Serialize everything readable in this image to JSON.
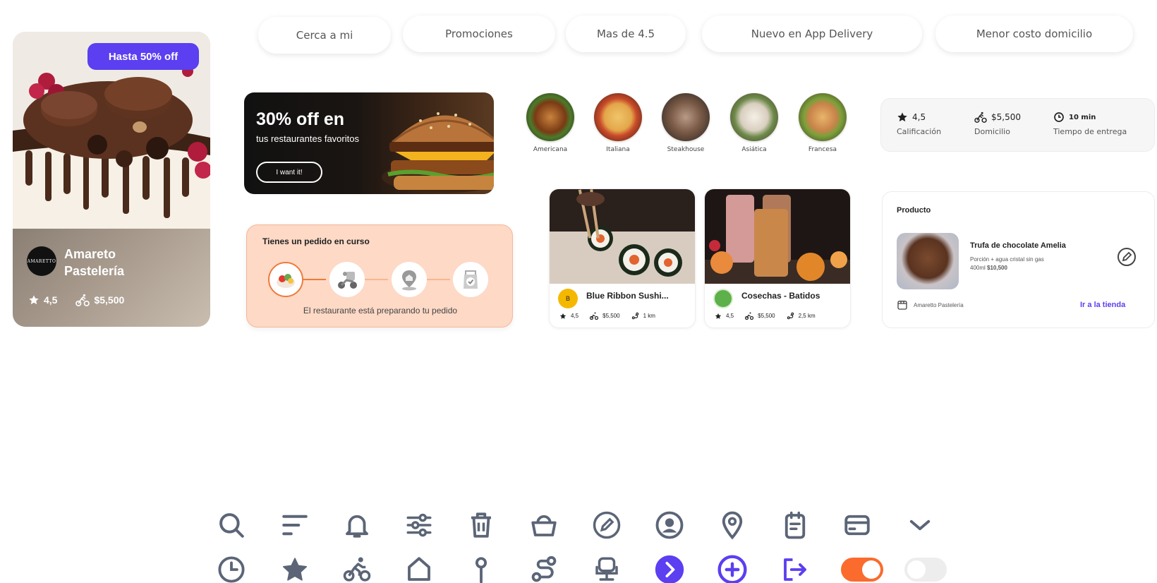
{
  "filters": [
    "Cerca a mi",
    "Promociones",
    "Mas de 4.5",
    "Nuevo en App Delivery",
    "Menor costo domicilio"
  ],
  "pastry_card": {
    "badge": "Hasta 50% off",
    "logo_text": "AMARETTO",
    "name": "Amareto Pastelería",
    "rating": "4,5",
    "delivery": "$5,500"
  },
  "banner": {
    "title": "30% off en",
    "subtitle": "tus restaurantes favoritos",
    "cta": "I want it!"
  },
  "categories": [
    {
      "label": "Americana"
    },
    {
      "label": "Italiana"
    },
    {
      "label": "Steakhouse"
    },
    {
      "label": "Asiática"
    },
    {
      "label": "Francesa"
    }
  ],
  "stats": {
    "rating_value": "4,5",
    "rating_label": "Calificación",
    "delivery_value": "$5,500",
    "delivery_label": "Domicilio",
    "time_value": "10 min",
    "time_label": "Tiempo de entrega"
  },
  "order": {
    "title": "Tienes un pedido en curso",
    "status": "El restaurante está preparando tu pedido"
  },
  "restaurants": [
    {
      "name": "Blue Ribbon Sushi...",
      "logo": "B",
      "rating": "4,5",
      "delivery": "$5,500",
      "distance": "1 km"
    },
    {
      "name": "Cosechas - Batidos",
      "logo": "",
      "rating": "4,5",
      "delivery": "$5,500",
      "distance": "2,5 km"
    }
  ],
  "product": {
    "header": "Producto",
    "name": "Trufa de chocolate Amelia",
    "desc_line1": "Porción + agua cristal sin gas",
    "desc_size": "400ml",
    "desc_price": "$10,500",
    "store": "Amaretto Pastelería",
    "link": "Ir a la tienda"
  },
  "colors": {
    "accent": "#5b3ff0",
    "orange": "#fa6b2d",
    "icon": "#5b6577",
    "order_bg": "#fdd9c6"
  },
  "icons_row1": [
    "search-icon",
    "sort-icon",
    "bell-icon",
    "filter-sliders-icon",
    "trash-icon",
    "basket-icon",
    "edit-circle-icon",
    "user-circle-icon",
    "location-pin-icon",
    "notepad-icon",
    "card-icon",
    "chevron-down-icon"
  ],
  "icons_row2": [
    "clock-icon",
    "star-icon",
    "cyclist-icon",
    "home-icon",
    "pin-icon",
    "route-icon",
    "chair-icon",
    "next-circle-icon",
    "add-circle-icon",
    "logout-icon"
  ],
  "toggles": {
    "on": true,
    "off": false
  }
}
